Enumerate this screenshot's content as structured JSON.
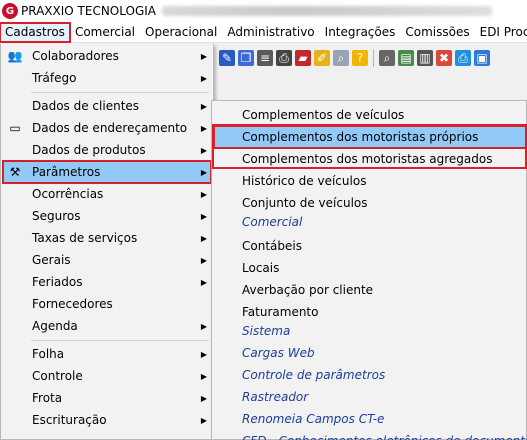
{
  "app": {
    "title": "PRAXXIO TECNOLOGIA"
  },
  "menubar": {
    "items": [
      "Cadastros",
      "Comercial",
      "Operacional",
      "Administrativo",
      "Integrações",
      "Comissões",
      "EDI Proceda"
    ]
  },
  "cadastros_menu": {
    "items": [
      {
        "label": "Colaboradores",
        "icon": "users-icon",
        "has_submenu": true
      },
      {
        "label": "Tráfego",
        "icon": "",
        "has_submenu": true
      },
      {
        "label": "Dados de clientes",
        "icon": "",
        "has_submenu": true
      },
      {
        "label": "Dados de endereçamento",
        "icon": "address-card-icon",
        "has_submenu": true
      },
      {
        "label": "Dados de produtos",
        "icon": "",
        "has_submenu": true
      },
      {
        "label": "Parâmetros",
        "icon": "settings-tools-icon",
        "has_submenu": true
      },
      {
        "label": "Ocorrências",
        "icon": "",
        "has_submenu": true
      },
      {
        "label": "Seguros",
        "icon": "",
        "has_submenu": true
      },
      {
        "label": "Taxas de serviços",
        "icon": "",
        "has_submenu": true
      },
      {
        "label": "Gerais",
        "icon": "",
        "has_submenu": true
      },
      {
        "label": "Feriados",
        "icon": "",
        "has_submenu": true
      },
      {
        "label": "Fornecedores",
        "icon": "",
        "has_submenu": false
      },
      {
        "label": "Agenda",
        "icon": "",
        "has_submenu": true
      },
      {
        "label": "Folha",
        "icon": "",
        "has_submenu": true
      },
      {
        "label": "Controle",
        "icon": "",
        "has_submenu": true
      },
      {
        "label": "Frota",
        "icon": "",
        "has_submenu": true
      },
      {
        "label": "Escrituração",
        "icon": "",
        "has_submenu": true
      }
    ]
  },
  "parametros_menu": {
    "items": [
      {
        "label": "Complementos de veículos",
        "group": false
      },
      {
        "label": "Complementos dos motoristas próprios",
        "group": false
      },
      {
        "label": "Complementos dos motoristas agregados",
        "group": false
      },
      {
        "label": "Histórico de veículos",
        "group": false
      },
      {
        "label": "Conjunto de veículos",
        "group": false
      },
      {
        "label": "Comercial",
        "group": true
      },
      {
        "label": "Contábeis",
        "group": false
      },
      {
        "label": "Locais",
        "group": false
      },
      {
        "label": "Averbação por cliente",
        "group": false
      },
      {
        "label": "Faturamento",
        "group": false
      },
      {
        "label": "Sistema",
        "group": true
      },
      {
        "label": "Cargas Web",
        "group": true
      },
      {
        "label": "Controle de parâmetros",
        "group": true
      },
      {
        "label": "Rastreador",
        "group": true
      },
      {
        "label": "Renomeia Campos CT-e",
        "group": true
      },
      {
        "label": "CFD - Conhecimentos eletrônicos de documentos",
        "group": true
      }
    ]
  },
  "colors": {
    "highlight": "#91c9f7",
    "callout_red": "#d9202a",
    "group_label": "#1c3f99"
  }
}
